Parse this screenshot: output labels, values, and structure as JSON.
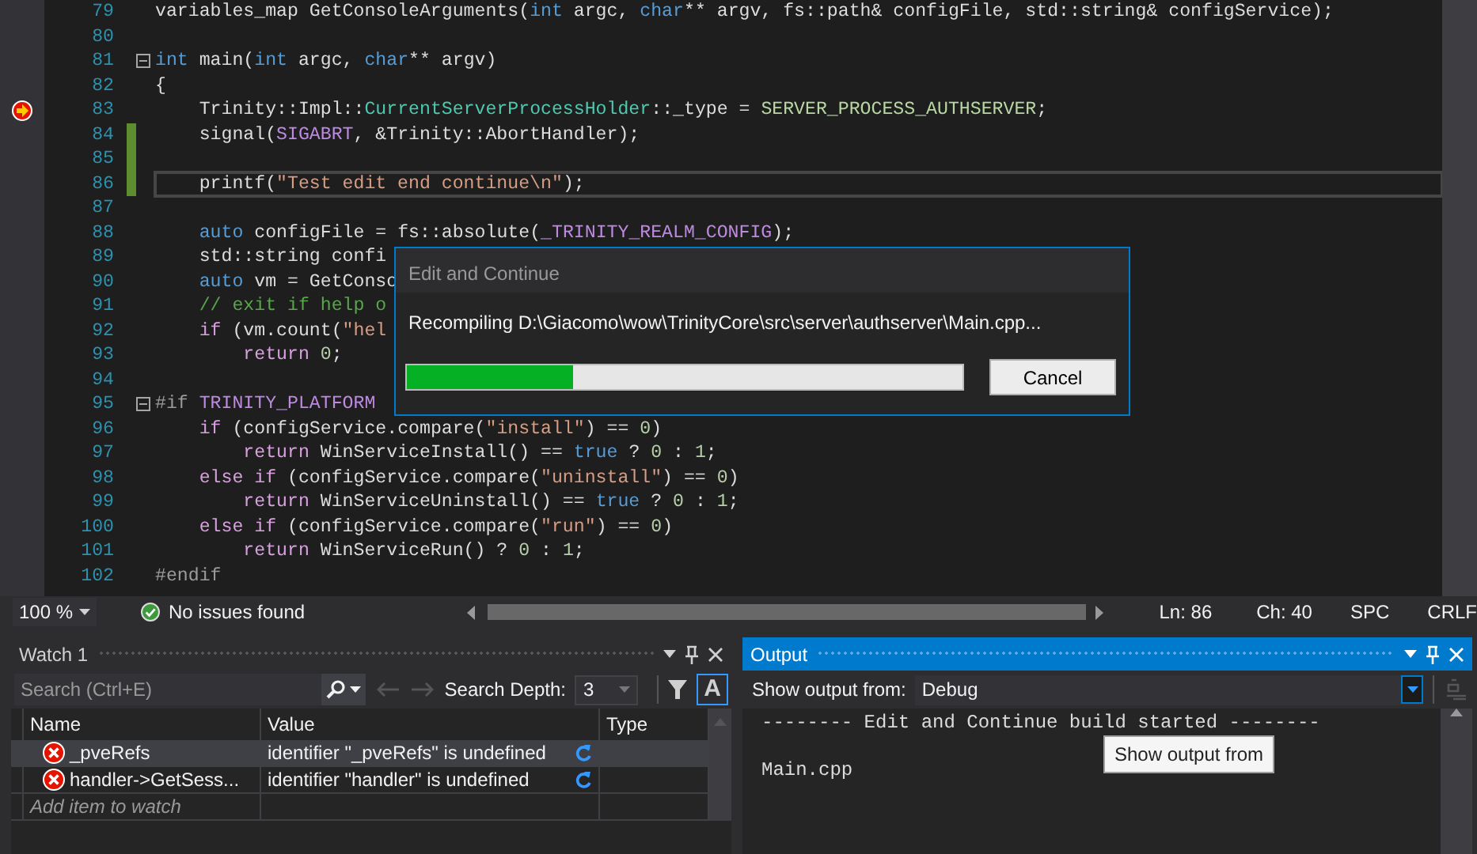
{
  "editor": {
    "lines": [
      {
        "number": "79",
        "breakpoint": false,
        "changed": false,
        "current": false,
        "foldable": false,
        "tokens": [
          {
            "kind": "plain",
            "text": "variables_map GetConsoleArguments("
          },
          {
            "kind": "keyword",
            "text": "int"
          },
          {
            "kind": "plain",
            "text": " argc, "
          },
          {
            "kind": "keyword",
            "text": "char"
          },
          {
            "kind": "plain",
            "text": "** argv, fs::path& configFile, std::string& configService);"
          }
        ]
      },
      {
        "number": "80",
        "breakpoint": false,
        "changed": false,
        "current": false,
        "foldable": false
      },
      {
        "number": "81",
        "breakpoint": false,
        "changed": false,
        "current": false,
        "foldable": true,
        "tokens": [
          {
            "kind": "keyword",
            "text": "int"
          },
          {
            "kind": "plain",
            "text": " main("
          },
          {
            "kind": "keyword",
            "text": "int"
          },
          {
            "kind": "plain",
            "text": " argc, "
          },
          {
            "kind": "keyword",
            "text": "char"
          },
          {
            "kind": "plain",
            "text": "** argv)"
          }
        ]
      },
      {
        "number": "82",
        "breakpoint": false,
        "changed": false,
        "current": false,
        "foldable": false,
        "tokens": [
          {
            "kind": "plain",
            "text": "{"
          }
        ]
      },
      {
        "number": "83",
        "breakpoint": true,
        "changed": false,
        "current": false,
        "foldable": false,
        "tokens": [
          {
            "kind": "plain",
            "text": "    Trinity::Impl::"
          },
          {
            "kind": "type",
            "text": "CurrentServerProcessHolder"
          },
          {
            "kind": "plain",
            "text": "::_type = "
          },
          {
            "kind": "enum",
            "text": "SERVER_PROCESS_AUTHSERVER"
          },
          {
            "kind": "plain",
            "text": ";"
          }
        ]
      },
      {
        "number": "84",
        "breakpoint": false,
        "changed": true,
        "current": false,
        "foldable": false,
        "tokens": [
          {
            "kind": "plain",
            "text": "    signal("
          },
          {
            "kind": "macro",
            "text": "SIGABRT"
          },
          {
            "kind": "plain",
            "text": ", &Trinity::AbortHandler);"
          }
        ]
      },
      {
        "number": "85",
        "breakpoint": false,
        "changed": true,
        "current": false,
        "foldable": false
      },
      {
        "number": "86",
        "breakpoint": false,
        "changed": true,
        "current": true,
        "foldable": false,
        "tokens": [
          {
            "kind": "plain",
            "text": "    printf("
          },
          {
            "kind": "string",
            "text": "\"Test edit end continue\\n\""
          },
          {
            "kind": "plain",
            "text": ");"
          }
        ]
      },
      {
        "number": "87",
        "breakpoint": false,
        "changed": false,
        "current": false,
        "foldable": false
      },
      {
        "number": "88",
        "breakpoint": false,
        "changed": false,
        "current": false,
        "foldable": false,
        "tokens": [
          {
            "kind": "keyword",
            "text": "    auto"
          },
          {
            "kind": "plain",
            "text": " configFile = fs::absolute("
          },
          {
            "kind": "macro",
            "text": "_TRINITY_REALM_CONFIG"
          },
          {
            "kind": "plain",
            "text": ");"
          }
        ]
      },
      {
        "number": "89",
        "breakpoint": false,
        "changed": false,
        "current": false,
        "foldable": false,
        "tokens": [
          {
            "kind": "plain",
            "text": "    std::string confi"
          }
        ]
      },
      {
        "number": "90",
        "breakpoint": false,
        "changed": false,
        "current": false,
        "foldable": false,
        "tokens": [
          {
            "kind": "keyword",
            "text": "    auto"
          },
          {
            "kind": "plain",
            "text": " vm = GetConso"
          }
        ]
      },
      {
        "number": "91",
        "breakpoint": false,
        "changed": false,
        "current": false,
        "foldable": false,
        "tokens": [
          {
            "kind": "comment",
            "text": "    // exit if help o"
          }
        ]
      },
      {
        "number": "92",
        "breakpoint": false,
        "changed": false,
        "current": false,
        "foldable": false,
        "tokens": [
          {
            "kind": "control",
            "text": "    if"
          },
          {
            "kind": "plain",
            "text": " (vm.count("
          },
          {
            "kind": "string",
            "text": "\"hel"
          }
        ]
      },
      {
        "number": "93",
        "breakpoint": false,
        "changed": false,
        "current": false,
        "foldable": false,
        "tokens": [
          {
            "kind": "control",
            "text": "        return"
          },
          {
            "kind": "number",
            "text": " 0"
          },
          {
            "kind": "plain",
            "text": ";"
          }
        ]
      },
      {
        "number": "94",
        "breakpoint": false,
        "changed": false,
        "current": false,
        "foldable": false
      },
      {
        "number": "95",
        "breakpoint": false,
        "changed": false,
        "current": false,
        "foldable": true,
        "tokens": [
          {
            "kind": "preprocessor",
            "text": "#if"
          },
          {
            "kind": "macro",
            "text": " TRINITY_PLATFORM"
          }
        ]
      },
      {
        "number": "96",
        "breakpoint": false,
        "changed": false,
        "current": false,
        "foldable": false,
        "tokens": [
          {
            "kind": "control",
            "text": "    if"
          },
          {
            "kind": "plain",
            "text": " (configService.compare("
          },
          {
            "kind": "string",
            "text": "\"install\""
          },
          {
            "kind": "plain",
            "text": ") == "
          },
          {
            "kind": "number",
            "text": "0"
          },
          {
            "kind": "plain",
            "text": ")"
          }
        ]
      },
      {
        "number": "97",
        "breakpoint": false,
        "changed": false,
        "current": false,
        "foldable": false,
        "tokens": [
          {
            "kind": "control",
            "text": "        return"
          },
          {
            "kind": "plain",
            "text": " WinServiceInstall() == "
          },
          {
            "kind": "keyword",
            "text": "true"
          },
          {
            "kind": "plain",
            "text": " ? "
          },
          {
            "kind": "number",
            "text": "0"
          },
          {
            "kind": "plain",
            "text": " : "
          },
          {
            "kind": "number",
            "text": "1"
          },
          {
            "kind": "plain",
            "text": ";"
          }
        ]
      },
      {
        "number": "98",
        "breakpoint": false,
        "changed": false,
        "current": false,
        "foldable": false,
        "tokens": [
          {
            "kind": "control",
            "text": "    else if"
          },
          {
            "kind": "plain",
            "text": " (configService.compare("
          },
          {
            "kind": "string",
            "text": "\"uninstall\""
          },
          {
            "kind": "plain",
            "text": ") == "
          },
          {
            "kind": "number",
            "text": "0"
          },
          {
            "kind": "plain",
            "text": ")"
          }
        ]
      },
      {
        "number": "99",
        "breakpoint": false,
        "changed": false,
        "current": false,
        "foldable": false,
        "tokens": [
          {
            "kind": "control",
            "text": "        return"
          },
          {
            "kind": "plain",
            "text": " WinServiceUninstall() == "
          },
          {
            "kind": "keyword",
            "text": "true"
          },
          {
            "kind": "plain",
            "text": " ? "
          },
          {
            "kind": "number",
            "text": "0"
          },
          {
            "kind": "plain",
            "text": " : "
          },
          {
            "kind": "number",
            "text": "1"
          },
          {
            "kind": "plain",
            "text": ";"
          }
        ]
      },
      {
        "number": "100",
        "breakpoint": false,
        "changed": false,
        "current": false,
        "foldable": false,
        "tokens": [
          {
            "kind": "control",
            "text": "    else if"
          },
          {
            "kind": "plain",
            "text": " (configService.compare("
          },
          {
            "kind": "string",
            "text": "\"run\""
          },
          {
            "kind": "plain",
            "text": ") == "
          },
          {
            "kind": "number",
            "text": "0"
          },
          {
            "kind": "plain",
            "text": ")"
          }
        ]
      },
      {
        "number": "101",
        "breakpoint": false,
        "changed": false,
        "current": false,
        "foldable": false,
        "tokens": [
          {
            "kind": "control",
            "text": "        return"
          },
          {
            "kind": "plain",
            "text": " WinServiceRun() ? "
          },
          {
            "kind": "number",
            "text": "0"
          },
          {
            "kind": "plain",
            "text": " : "
          },
          {
            "kind": "number",
            "text": "1"
          },
          {
            "kind": "plain",
            "text": ";"
          }
        ]
      },
      {
        "number": "102",
        "breakpoint": false,
        "changed": false,
        "current": false,
        "foldable": false,
        "tokens": [
          {
            "kind": "preprocessor",
            "text": "#endif"
          }
        ]
      }
    ]
  },
  "dialog": {
    "title": "Edit and Continue",
    "message": "Recompiling D:\\Giacomo\\wow\\TrinityCore\\src\\server\\authserver\\Main.cpp...",
    "level": 0.3,
    "button": "Cancel"
  },
  "status_bar": {
    "zoom": "100 %",
    "issues": "No issues found",
    "line": "Ln: 86",
    "column": "Ch: 40",
    "indent": "SPC",
    "line_ending": "CRLF"
  },
  "watch": {
    "title": "Watch 1",
    "active": false,
    "search_placeholder": "Search (Ctrl+E)",
    "depth_label": "Search Depth:",
    "depth": "3",
    "case_toggle": "A",
    "columns": [
      "Name",
      "Value",
      "Type"
    ],
    "rows": [
      {
        "name": "_pveRefs",
        "value": "identifier \"_pveRefs\" is undefined",
        "error": true,
        "selected": true
      },
      {
        "name": "handler->GetSess...",
        "value": "identifier \"handler\" is undefined",
        "error": true,
        "selected": false
      }
    ],
    "add_placeholder": "Add item to watch"
  },
  "output": {
    "title": "Output",
    "active": true,
    "source_label": "Show output from:",
    "source": "Debug",
    "text": "-------- Edit and Continue build started --------\n\nMain.cpp",
    "tooltip": "Show output from"
  }
}
